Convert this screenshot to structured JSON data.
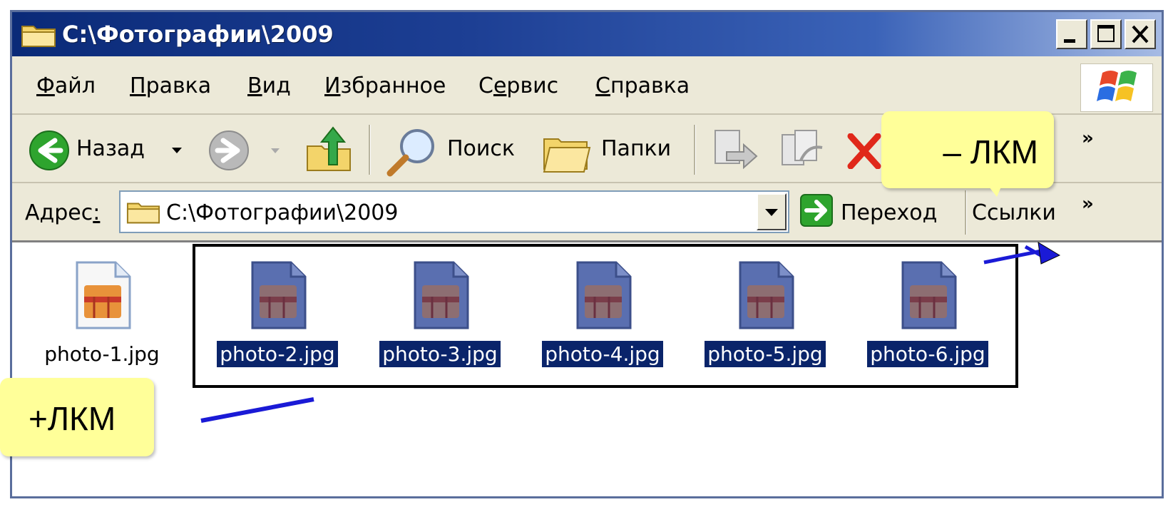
{
  "window": {
    "title": "C:\\Фотографии\\2009",
    "buttons": [
      "minimize-icon",
      "maximize-icon",
      "close-icon"
    ]
  },
  "menubar": {
    "items": [
      {
        "accel": "Ф",
        "rest": "айл"
      },
      {
        "accel": "П",
        "rest": "равка"
      },
      {
        "accel": "В",
        "rest": "ид"
      },
      {
        "accel": "И",
        "rest": "збранное"
      },
      {
        "pre": "С",
        "accel": "е",
        "rest": "рвис"
      },
      {
        "accel": "С",
        "rest": "правка"
      }
    ]
  },
  "toolbar": {
    "back_label": "Назад",
    "search_label": "Поиск",
    "folders_label": "Папки",
    "more": "»"
  },
  "address": {
    "label_pre": "Адрес",
    "label_accel": ":",
    "value": "C:\\Фотографии\\2009",
    "go_label": "Переход",
    "links_label": "Ссылки",
    "more": "»"
  },
  "files": [
    {
      "name": "photo-1.jpg",
      "selected": false
    },
    {
      "name": "photo-2.jpg",
      "selected": true
    },
    {
      "name": "photo-3.jpg",
      "selected": true
    },
    {
      "name": "photo-4.jpg",
      "selected": true
    },
    {
      "name": "photo-5.jpg",
      "selected": true
    },
    {
      "name": "photo-6.jpg",
      "selected": true
    }
  ],
  "callouts": {
    "minus": "– ЛКМ",
    "plus": "+ЛКМ"
  },
  "colors": {
    "callout_bg": "#ffff99",
    "selection_bg": "#0a246a",
    "titlebar": "#0a2a78",
    "arrow": "#1a1ad6"
  }
}
